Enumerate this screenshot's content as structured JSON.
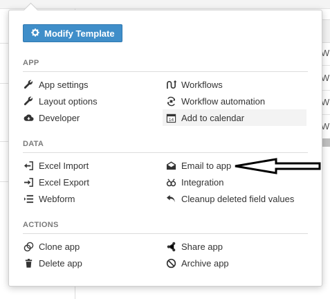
{
  "popover": {
    "modify_template_label": "Modify Template",
    "sections": {
      "app": {
        "title": "APP",
        "left": [
          "App settings",
          "Layout options",
          "Developer"
        ],
        "right": [
          "Workflows",
          "Workflow automation",
          "Add to calendar"
        ]
      },
      "data": {
        "title": "DATA",
        "left": [
          "Excel Import",
          "Excel Export",
          "Webform"
        ],
        "right": [
          "Email to app",
          "Integration",
          "Cleanup deleted field values"
        ]
      },
      "actions": {
        "title": "ACTIONS",
        "left": [
          "Clone app",
          "Delete app"
        ],
        "right": [
          "Share app",
          "Archive app"
        ]
      }
    }
  },
  "background": {
    "cell_texts": [
      "W",
      "W",
      "W",
      "W"
    ]
  },
  "colors": {
    "primary_button": "#3f8ec9",
    "icon": "#333333",
    "section_title": "#7a7a7a",
    "hover_row": "#f3f3f3"
  },
  "icons": {
    "modify_template": "gear-icon",
    "app_settings": "wrench-icon",
    "layout_options": "wrench-icon",
    "developer": "cloud-icon",
    "workflows": "workflow-icon",
    "workflow_automation": "automation-icon",
    "add_to_calendar": "calendar-icon",
    "excel_import": "import-icon",
    "excel_export": "export-icon",
    "webform": "list-icon",
    "email_to_app": "envelope-icon",
    "integration": "integration-icon",
    "cleanup": "undo-icon",
    "clone_app": "clone-icon",
    "delete_app": "trash-icon",
    "share_app": "share-icon",
    "archive_app": "ban-icon",
    "annotation": "arrow-left-icon"
  }
}
